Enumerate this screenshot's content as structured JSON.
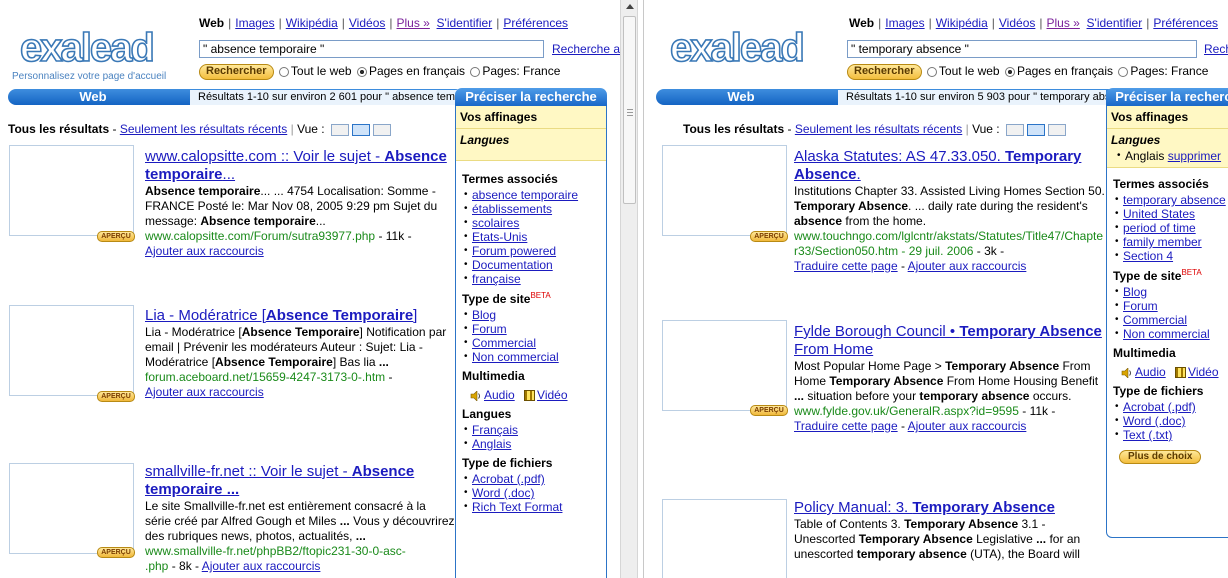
{
  "common": {
    "logo": "exalead",
    "logo_sub": "Personnalisez votre page d'accueil",
    "links": {
      "web": "Web",
      "images": "Images",
      "wikipedia": "Wikipédia",
      "videos": "Vidéos",
      "plus": "Plus »",
      "identify": "S'identifier",
      "preferences": "Préférences"
    },
    "advanced_search": "Recherche avancée",
    "search_button": "Rechercher",
    "opt_all": "Tout le web",
    "opt_fr": "Pages en français",
    "opt_country": "Pages: France",
    "web_tab": "Web",
    "refine_title": "Préciser la recherche",
    "your_refinements": "Vos affinages",
    "filters": {
      "all": "Tous les résultats",
      "recent": "Seulement les résultats récents",
      "view": "Vue :"
    },
    "apercu": "APERÇU",
    "add_shortcut": "Ajouter aux raccourcis",
    "translate": "Traduire cette page",
    "beta": "BETA"
  },
  "left": {
    "query": "\" absence temporaire \"",
    "results_count": "Résultats 1-10 sur environ 2 601 pour \" absence temporaire \"",
    "refine": {
      "languages_heading": "Langues",
      "related_heading": "Termes associés",
      "related": [
        "absence temporaire",
        "établissements",
        "scolaires",
        "Etats-Unis",
        "Forum powered",
        "Documentation",
        "française"
      ],
      "site_type_heading": "Type de site",
      "site_types": [
        "Blog",
        "Forum",
        "Commercial",
        "Non commercial"
      ],
      "multimedia_heading": "Multimedia",
      "audio": "Audio",
      "video": "Vidéo",
      "langues_heading2": "Langues",
      "langs": [
        "Français",
        "Anglais"
      ],
      "filetype_heading": "Type de fichiers",
      "filetypes": [
        "Acrobat (.pdf)",
        "Word (.doc)",
        "Rich Text Format"
      ]
    },
    "results": [
      {
        "title_a": "www.calopsitte.com :: Voir le sujet - ",
        "title_b": "Absence temporaire",
        "title_c": "...",
        "s1b": "Absence temporaire",
        "s1": "... ... 4754 Localisation: Somme - FRANCE Posté le: Mar Nov 08, 2005 9:29 pm Sujet du message: ",
        "s1c": "Absence temporaire",
        "s1d": "...",
        "url": "www.calopsitte.com/Forum/sutra93977.php",
        "size": " - 11k -"
      },
      {
        "title_a": "Lia - Modératrice [",
        "title_b": "Absence Temporaire",
        "title_c": "]",
        "s1": "Lia - Modératrice [",
        "s1b": "Absence Temporaire",
        "s1c": "] Notification par email | Prévenir les modérateurs Auteur : Sujet: Lia - Modératrice [",
        "s1d": "Absence Temporaire",
        "s1e": "] Bas lia ",
        "s1f": "...",
        "url": "forum.aceboard.net/15659-4247-3173-0-.htm",
        "size": " -"
      },
      {
        "title_a": "smallville-fr.net :: Voir le sujet - ",
        "title_b": "Absence temporaire ...",
        "s1": "Le site Smallville-fr.net est entièrement consacré à la série créé par Alfred Gough et Miles ",
        "s1b": "...",
        "s1c": " Vous y découvrirez des rubriques news, photos, actualités, ",
        "s1d": "...",
        "url": "www.smallville-fr.net/phpBB2/ftopic231-30-0-asc-",
        "url2": ".php",
        "size": " - 8k -"
      }
    ]
  },
  "right": {
    "query": "\" temporary absence \"",
    "results_count": "Résultats 1-10 sur environ 5 903 pour \" temporary absence \"",
    "refine": {
      "languages_heading": "Langues",
      "lang_selected": "Anglais",
      "remove": "supprimer",
      "related_heading": "Termes associés",
      "related": [
        "temporary absence",
        "United States",
        "period of time",
        "family member",
        "Section 4"
      ],
      "site_type_heading": "Type de site",
      "site_types": [
        "Blog",
        "Forum",
        "Commercial",
        "Non commercial"
      ],
      "multimedia_heading": "Multimedia",
      "audio": "Audio",
      "video": "Vidéo",
      "filetype_heading": "Type de fichiers",
      "filetypes": [
        "Acrobat (.pdf)",
        "Word (.doc)",
        "Text (.txt)"
      ],
      "more": "Plus de choix"
    },
    "results": [
      {
        "title_a": "Alaska Statutes: AS 47.33.050. ",
        "title_b": "Temporary Absence",
        "title_c": ".",
        "s1": "Institutions Chapter 33. Assisted Living Homes Section 50. ",
        "s1b": "Temporary Absence",
        "s1c": ". ... daily rate during the resident's ",
        "s1d": "absence",
        "s1e": " from the home.",
        "url": "www.touchngo.com/lglcntr/akstats/Statutes/Title47/Chapter33/Section050.htm - 29 juil. 2006",
        "size": " - 3k -"
      },
      {
        "title_a": "Fylde Borough Council • ",
        "title_b": "Temporary Absence",
        "title_c": " From Home",
        "s1": "Most Popular Home Page > ",
        "s1b": "Temporary Absence",
        "s1c": " From Home ",
        "s1d": "Temporary Absence",
        "s1e": " From Home Housing Benefit ",
        "s1f": "...",
        "s1g": " situation before your ",
        "s1h": "temporary absence",
        "s1i": " occurs.",
        "url": "www.fylde.gov.uk/GeneralR.aspx?id=9595",
        "size": " - 11k -"
      },
      {
        "title_a": "Policy Manual: 3. ",
        "title_b": "Temporary Absence",
        "s1": "Table of Contents 3. ",
        "s1b": "Temporary Absence",
        "s1c": " 3.1 - Unescorted ",
        "s1d": "Temporary Absence",
        "s1e": " Legislative ",
        "s1f": "...",
        "s1g": " for an unescorted ",
        "s1h": "temporary absence",
        "s1i": " (UTA), the Board will"
      }
    ]
  }
}
